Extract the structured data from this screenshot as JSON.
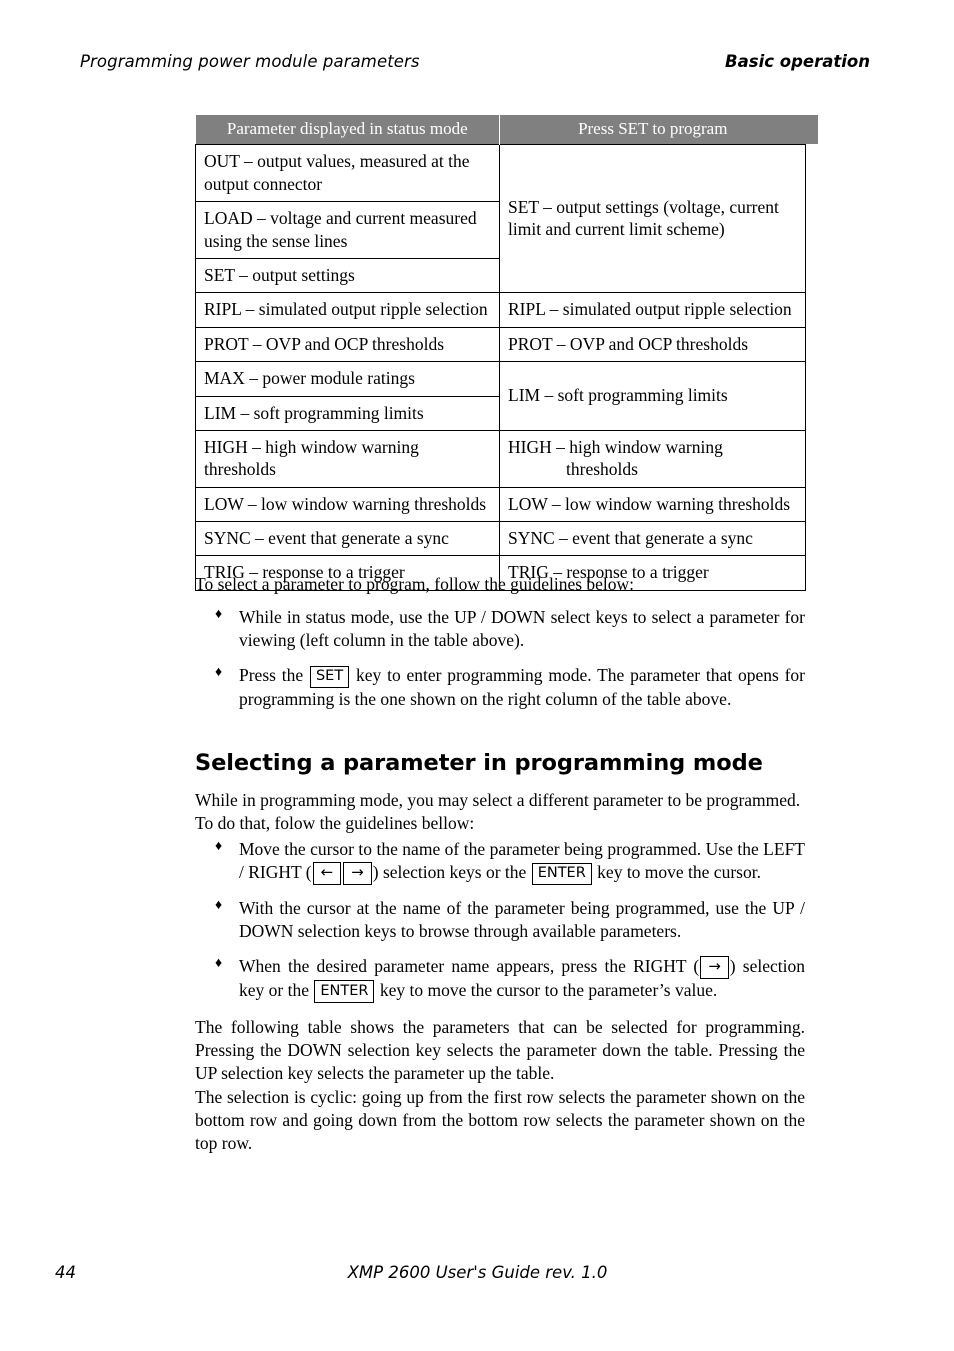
{
  "header": {
    "left": "Programming power module parameters",
    "right": "Basic operation"
  },
  "table": {
    "columns": [
      "Parameter displayed in status mode",
      "Press SET to program"
    ],
    "header_bg": "#808080",
    "header_fg": "#ffffff",
    "rows": [
      {
        "left": "OUT – output values, measured at the output connector",
        "right": "SET – output settings (voltage, current limit and current limit scheme)",
        "right_rowspan": 3
      },
      {
        "left": "LOAD – voltage and current measured using the sense lines"
      },
      {
        "left": "SET – output settings"
      },
      {
        "left": "RIPL – simulated output ripple selection",
        "right": "RIPL – simulated output ripple selection",
        "right_rowspan": 1
      },
      {
        "left": "PROT – OVP and OCP thresholds",
        "right": "PROT – OVP and OCP thresholds",
        "right_rowspan": 1
      },
      {
        "left": "MAX – power module ratings",
        "right": "LIM – soft programming limits",
        "right_rowspan": 2
      },
      {
        "left": "LIM – soft programming limits"
      },
      {
        "left": "HIGH – high window warning thresholds",
        "right_line1": "HIGH – high window warning",
        "right_line2": "thresholds",
        "right_rowspan": 1
      },
      {
        "left": "LOW – low window warning thresholds",
        "right": "LOW – low window warning thresholds",
        "right_rowspan": 1
      },
      {
        "left": "SYNC – event that generate a sync",
        "right": "SYNC – event that generate a sync",
        "right_rowspan": 1
      },
      {
        "left": "TRIG – response to a trigger",
        "right": "TRIG – response to a trigger",
        "right_rowspan": 1
      }
    ]
  },
  "body": {
    "lead_paragraph": "To select a parameter to program, follow the guidelines below:",
    "bullet_glyph": "♦",
    "bullets1": [
      {
        "text": "While in status mode, use the UP / DOWN select keys to select a parameter for viewing (left column in the table above)."
      },
      {
        "pre": "Press the ",
        "key": "SET",
        "post": " key to enter programming mode. The parameter that opens for programming is the one shown on the right column of the table above."
      }
    ],
    "heading": "Selecting a parameter in programming mode",
    "para_after_heading": "While in programming mode, you may select a different parameter to be programmed. To do that, folow the guidelines bellow:",
    "bullets2": [
      {
        "pre": "Move the cursor to the name of the parameter being programmed. Use the LEFT / RIGHT (",
        "key_left": "←",
        "key_right": "→",
        "mid": ") selection keys or the ",
        "key_enter": "ENTER",
        "post": " key to move the cursor."
      },
      {
        "text": "With the cursor at the name of the parameter being programmed, use the UP / DOWN selection keys to browse through available parameters."
      },
      {
        "pre": "When the desired parameter name appears, press the RIGHT (",
        "key_right": "→",
        "mid": ") selection key or the ",
        "key_enter": "ENTER",
        "post": " key to move the cursor to the parameter’s value."
      }
    ],
    "para_tail1": "The following table shows the parameters that can be selected for programming. Pressing the DOWN selection key selects the parameter down the table. Pressing the UP selection key selects the parameter up the table.",
    "para_tail2": "The selection is cyclic: going up from the first row selects the parameter shown on the bottom row and going down from the bottom row selects the parameter shown on the top row."
  },
  "footer": {
    "page_number": "44",
    "document": "XMP 2600 User's Guide rev. 1.0"
  }
}
